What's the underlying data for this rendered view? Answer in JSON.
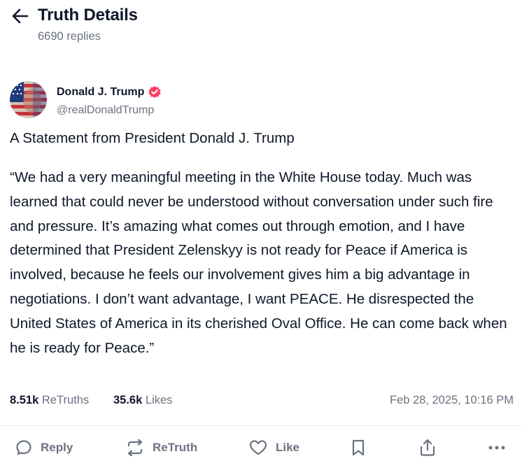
{
  "header": {
    "title": "Truth Details",
    "replies": "6690 replies"
  },
  "author": {
    "name": "Donald J. Trump",
    "handle": "@realDonaldTrump",
    "verified_color": "#ff4066"
  },
  "post": {
    "title": "A Statement from President Donald J. Trump",
    "body": "“We had a very meaningful meeting in the White House today. Much was learned that could never be understood without conversation under such fire and pressure. It’s amazing what comes out through emotion, and I have determined that President Zelenskyy is not ready for Peace if America is involved, because he feels our involvement gives him a big advantage in negotiations. I don’t want advantage, I want PEACE. He disrespected the United States of America in its cherished Oval Office. He can come back when he is ready for Peace.”"
  },
  "stats": {
    "retruths_count": "8.51k",
    "retruths_label": "ReTruths",
    "likes_count": "35.6k",
    "likes_label": "Likes",
    "timestamp": "Feb 28, 2025, 10:16 PM"
  },
  "actions": {
    "reply": "Reply",
    "retruth": "ReTruth",
    "like": "Like"
  },
  "icons": {
    "back": "arrow-left-icon",
    "verified": "verified-badge-icon",
    "reply": "speech-bubble-icon",
    "retruth": "retruth-arrows-icon",
    "like": "heart-icon",
    "bookmark": "bookmark-icon",
    "share": "share-icon",
    "more": "more-dots-icon"
  }
}
